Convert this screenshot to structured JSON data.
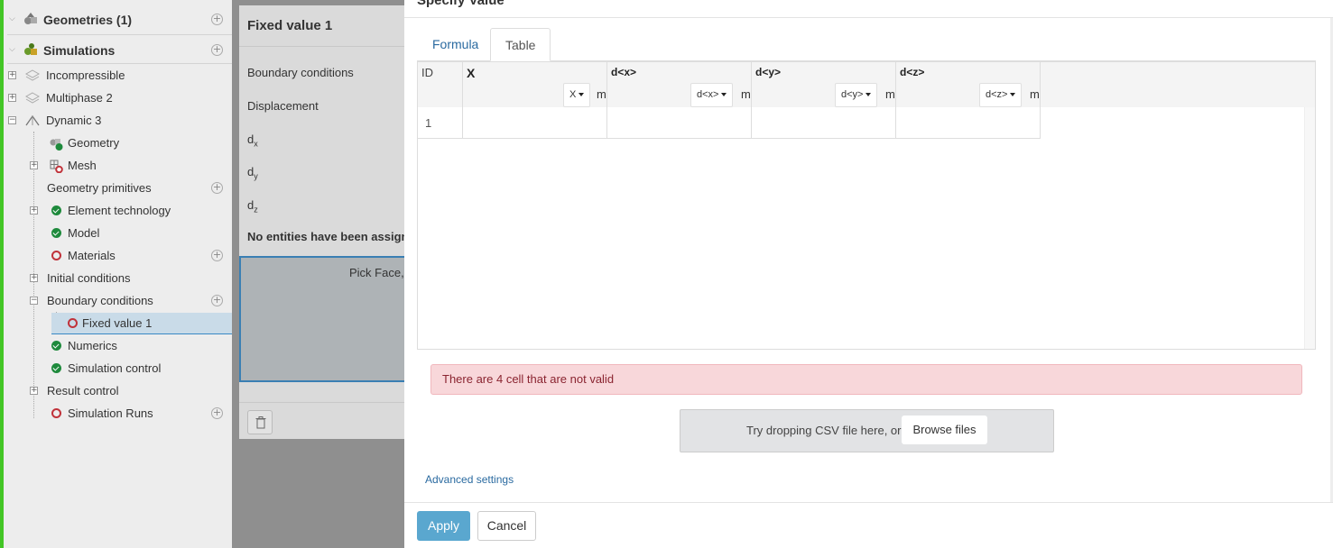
{
  "tree": {
    "items": [
      {
        "label": "Geometries (1)"
      },
      {
        "label": "Simulations"
      },
      {
        "label": "Incompressible"
      },
      {
        "label": "Multiphase 2"
      },
      {
        "label": "Dynamic 3"
      },
      {
        "label": "Geometry"
      },
      {
        "label": "Mesh"
      },
      {
        "label": "Geometry primitives"
      },
      {
        "label": "Element technology"
      },
      {
        "label": "Model"
      },
      {
        "label": "Materials"
      },
      {
        "label": "Initial conditions"
      },
      {
        "label": "Boundary conditions"
      },
      {
        "label": "Fixed value 1"
      },
      {
        "label": "Numerics"
      },
      {
        "label": "Simulation control"
      },
      {
        "label": "Result control"
      },
      {
        "label": "Simulation Runs"
      }
    ]
  },
  "middle": {
    "title": "Fixed value 1",
    "boundary_conditions": "Boundary conditions",
    "displacement": "Displacement",
    "dx_base": "d",
    "dx_sub": "x",
    "dy_base": "d",
    "dy_sub": "y",
    "dz_base": "d",
    "dz_sub": "z",
    "no_entities": "No entities have been assigned",
    "pick": "Pick Face, V"
  },
  "dialog": {
    "title": "Specify Value",
    "tabs": [
      {
        "label": "Formula"
      },
      {
        "label": "Table"
      }
    ],
    "active_tab": "Table",
    "table": {
      "id_header": "ID",
      "columns": [
        {
          "label": "X",
          "select": "X",
          "unit": "m"
        },
        {
          "label": "d<x>",
          "select": "d<x>",
          "unit": "m"
        },
        {
          "label": "d<y>",
          "select": "d<y>",
          "unit": "m"
        },
        {
          "label": "d<z>",
          "select": "d<z>",
          "unit": "m"
        }
      ],
      "rows": [
        {
          "id": "1"
        }
      ]
    },
    "alert": "There are 4 cell that are not valid",
    "drop_text": "Try dropping CSV file here, or",
    "browse_label": "Browse files",
    "advanced_label": "Advanced settings",
    "apply_label": "Apply",
    "cancel_label": "Cancel"
  },
  "colors": {
    "accent": "#5aa7cf",
    "link": "#2a6aa0",
    "error": "#c0323a",
    "success": "#1e8a3c",
    "alert_bg": "#f8d7da",
    "window_border": "#43c626"
  }
}
